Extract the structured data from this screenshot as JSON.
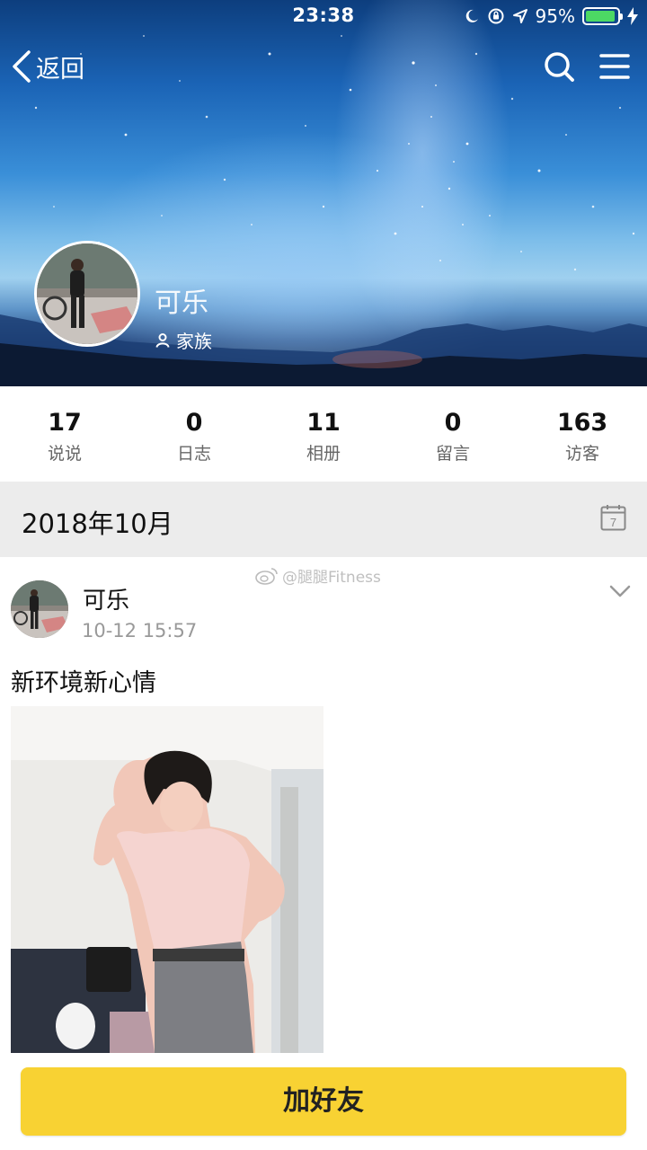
{
  "status_bar": {
    "time": "23:38",
    "battery_percent": "95%",
    "battery_level": 0.95,
    "icons": [
      "moon-icon",
      "orientation-lock-icon",
      "location-arrow-icon",
      "battery-icon",
      "charging-bolt-icon"
    ]
  },
  "nav": {
    "back_label": "返回",
    "icons": [
      "chevron-left-icon",
      "search-icon",
      "menu-icon"
    ]
  },
  "profile": {
    "name": "可乐",
    "tag": "家族",
    "tag_icon": "person-icon"
  },
  "stats": [
    {
      "value": "17",
      "label": "说说"
    },
    {
      "value": "0",
      "label": "日志"
    },
    {
      "value": "11",
      "label": "相册"
    },
    {
      "value": "0",
      "label": "留言"
    },
    {
      "value": "163",
      "label": "访客"
    }
  ],
  "timeline": {
    "month": "2018年10月",
    "calendar_day": "7"
  },
  "post": {
    "author": "可乐",
    "time": "10-12 15:57",
    "text": "新环境新心情",
    "watermark": "@腿腿Fitness"
  },
  "actions": {
    "add_friend": "加好友"
  },
  "colors": {
    "accent_yellow": "#f8d233",
    "battery_green": "#4cd964",
    "month_bar_bg": "#ececec"
  }
}
